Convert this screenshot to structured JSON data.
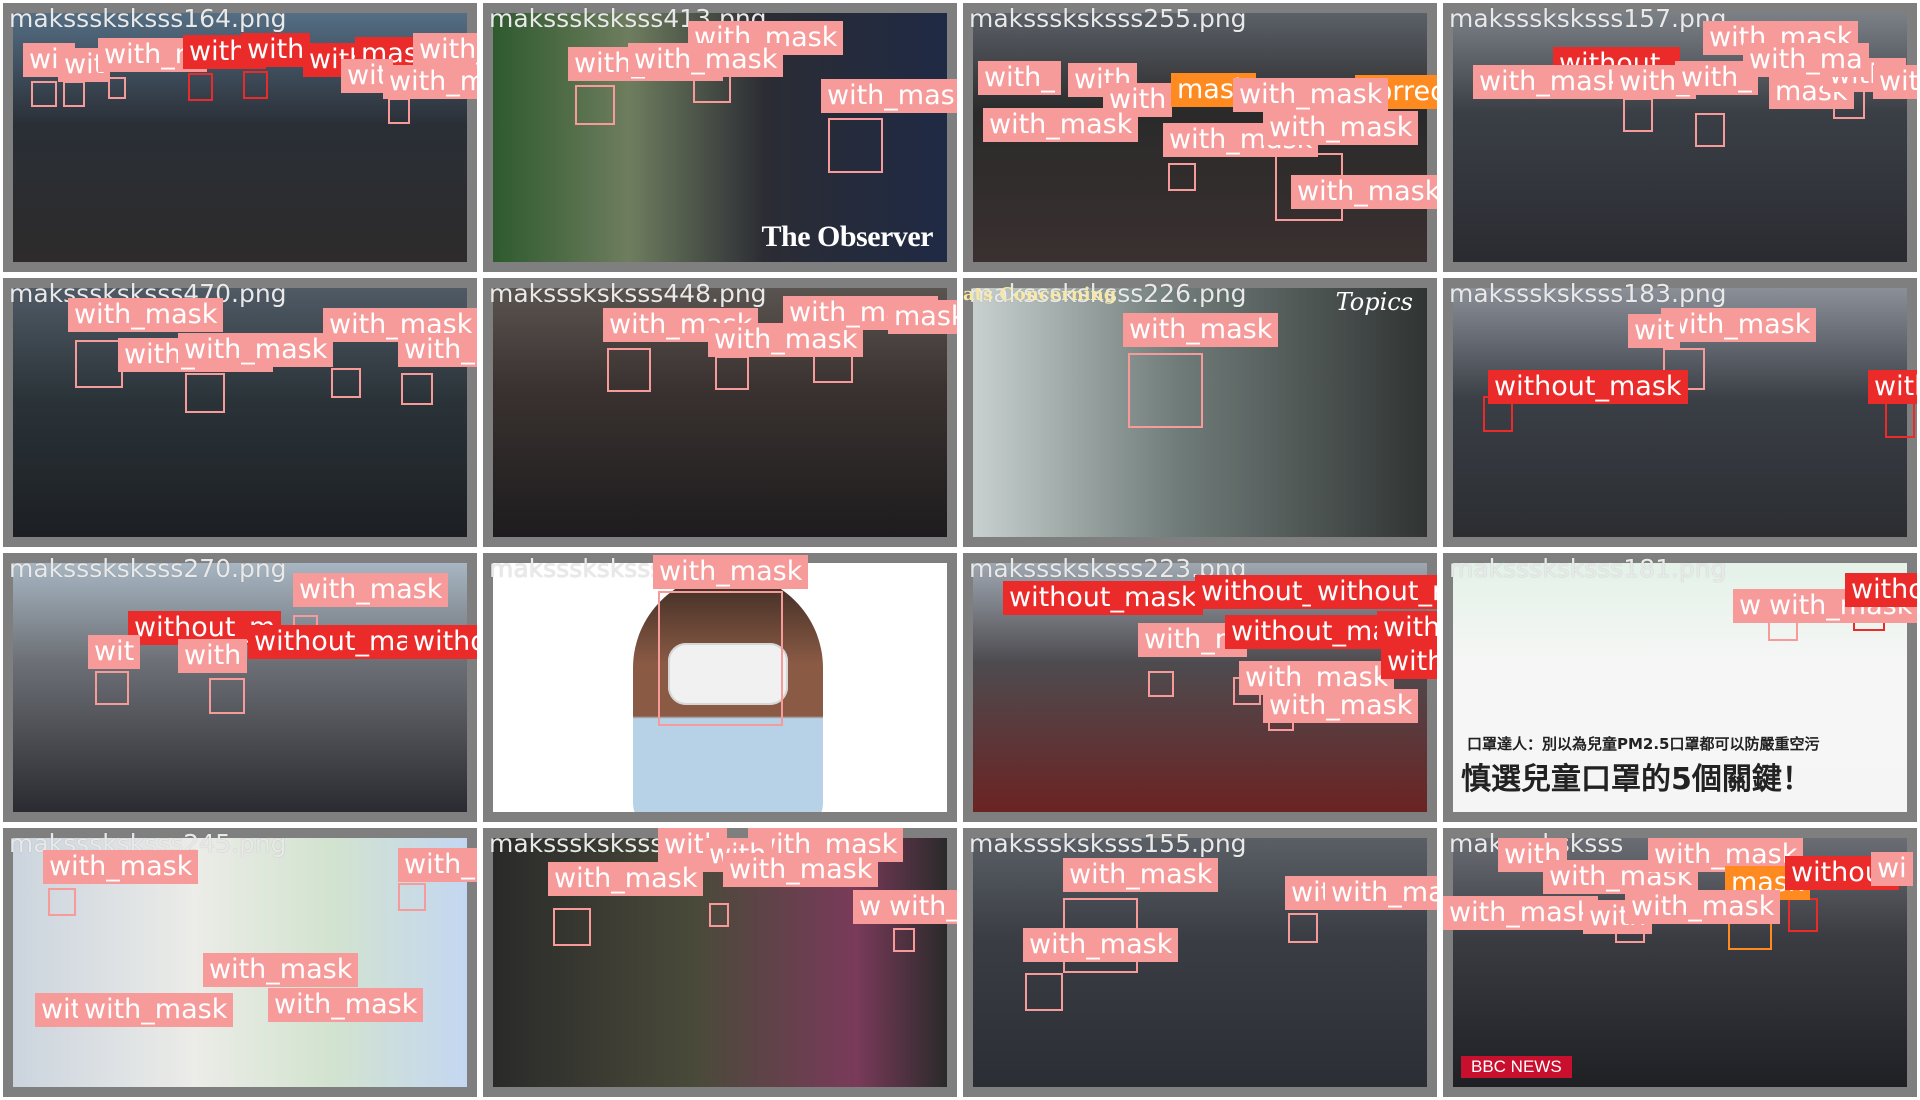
{
  "title": "",
  "colors": {
    "with_mask": "#f79a9a",
    "without_mask": "#eb2a2a",
    "mask_weared_incorrect": "#ff8a1f"
  },
  "tiles": [
    {
      "filename": "maksssksksss164.png",
      "labels": [
        "wit",
        "wit",
        "with_m",
        "with_",
        "with",
        "with",
        "mask",
        "with_mask",
        "wit",
        "with_mask"
      ]
    },
    {
      "filename": "maksssksksss413.png",
      "labels": [
        "with_mask",
        "with_mask",
        "with_mask",
        "with_mask"
      ],
      "overlay_text": "The Observer"
    },
    {
      "filename": "maksssksksss255.png",
      "labels": [
        "with_",
        "with",
        "with",
        "mask",
        "with_mask",
        "with_mask",
        "correc",
        "with_mask",
        "with_mask",
        "with_mask"
      ]
    },
    {
      "filename": "maksssksksss157.png",
      "labels": [
        "with_mask",
        "without_",
        "with_mask",
        "with_",
        "with_",
        "mask",
        "with_",
        "with_",
        "with_ma"
      ]
    },
    {
      "filename": "maksssksksss470.png",
      "labels": [
        "with_mask",
        "with_mask",
        "with_mask",
        "with_mask",
        "with_mask"
      ]
    },
    {
      "filename": "maksssksksss448.png",
      "labels": [
        "with_mask",
        "with_mask",
        "with_mask",
        "mask"
      ]
    },
    {
      "filename": "maksssksksss226.png",
      "labels": [
        "with_mask"
      ],
      "overlay_text": "Topics",
      "banner_text": "ats Concerning"
    },
    {
      "filename": "maksssksksss183.png",
      "labels": [
        "with_mask",
        "wit",
        "without_mask",
        "with"
      ]
    },
    {
      "filename": "maksssksksss270.png",
      "labels": [
        "with_mask",
        "without_m",
        "without_ma",
        "without_mask",
        "wit",
        "with"
      ]
    },
    {
      "filename": "maksssksksss",
      "labels": [
        "with_mask"
      ]
    },
    {
      "filename": "maksssksksss223.png",
      "labels": [
        "without_mask",
        "without_",
        "without_mask",
        "with_m",
        "without_ma",
        "with_mask",
        "without_mask",
        "without_mask",
        "with_mask"
      ]
    },
    {
      "filename": "maksssksksss181.png",
      "labels": [
        "wi",
        "with_mask",
        "without_ma"
      ],
      "caption_top": "口罩達人：別以為兒童PM2.5口罩都可以防嚴重空污",
      "caption_main": "慎選兒童口罩的5個關鍵！"
    },
    {
      "filename": "maksssksksss245.png",
      "labels": [
        "with_mask",
        "with_mask",
        "with_mask",
        "with_mask",
        "wit",
        "with_mask"
      ]
    },
    {
      "filename": "maksssksksss",
      "labels": [
        "with",
        "with_mask",
        "with_mask",
        "with",
        "with_mask",
        "w",
        "with_mask"
      ]
    },
    {
      "filename": "maksssksksss155.png",
      "labels": [
        "with_mask",
        "with_mask",
        "with_mask",
        "with_mask"
      ]
    },
    {
      "filename": "maksssksksss",
      "labels": [
        "with",
        "with_mask",
        "with_mask",
        "with_mask",
        "with",
        "mask",
        "with_mask",
        "without",
        "wi"
      ],
      "badge_text": "BBC NEWS"
    }
  ]
}
